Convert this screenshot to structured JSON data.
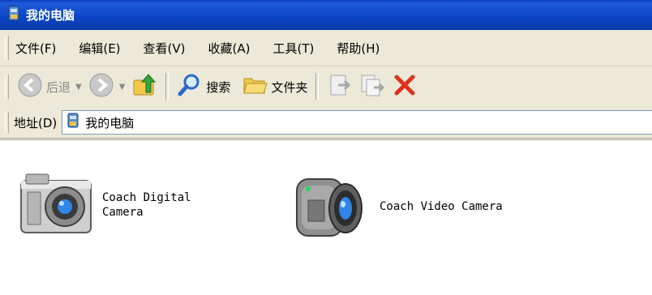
{
  "window": {
    "title": "我的电脑"
  },
  "menu": [
    "文件(F)",
    "编辑(E)",
    "查看(V)",
    "收藏(A)",
    "工具(T)",
    "帮助(H)"
  ],
  "toolbar": {
    "back": "后退",
    "search": "搜索",
    "folders": "文件夹"
  },
  "address": {
    "label": "地址(D)",
    "value": "我的电脑"
  },
  "items": [
    {
      "label_line1": "Coach Digital",
      "label_line2": "Camera",
      "icon": "digital-camera-icon"
    },
    {
      "label": "Coach Video Camera",
      "icon": "video-camera-icon"
    }
  ]
}
